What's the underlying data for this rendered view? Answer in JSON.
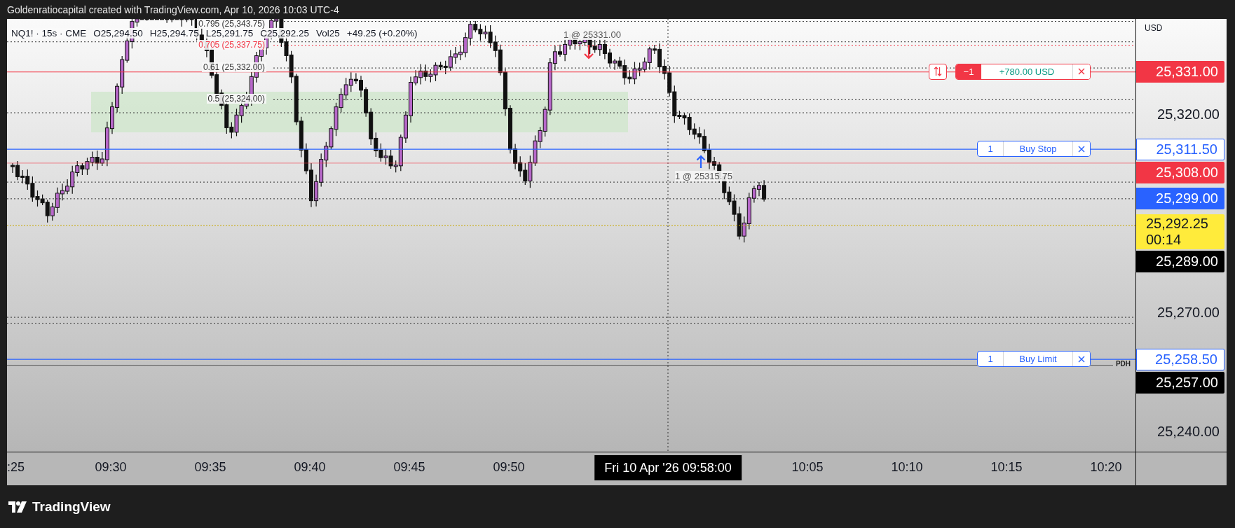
{
  "header": {
    "text": "Goldenratiocapital created with TradingView.com, Apr 10, 2026 10:03 UTC-4"
  },
  "legend": {
    "symbol": "NQ1! · 15s · CME",
    "open": "O25,294.50",
    "high": "H25,294.75",
    "low": "L25,291.75",
    "close": "C25,292.25",
    "volume": "Vol25",
    "change": "+49.25 (+0.20%)"
  },
  "fib_levels": [
    {
      "label": "0.795 (25,343.75)",
      "color": "#333333"
    },
    {
      "label": "0.705 (25,337.75)",
      "color": "#f23645"
    },
    {
      "label": "0.61 (25,332.00)",
      "color": "#333333"
    },
    {
      "label": "0.5 (25,324.00)",
      "color": "#333333"
    }
  ],
  "executions": [
    {
      "kind": "sell",
      "label": "1 @ 25331.00"
    },
    {
      "kind": "buy",
      "label": "1 @ 25315.75"
    }
  ],
  "orders": [
    {
      "kind": "position",
      "quantity": "−1",
      "pnl": "+780.00 USD",
      "price": "25,331.00",
      "color": "#f23645"
    },
    {
      "kind": "order",
      "quantity": "1",
      "label": "Buy Stop",
      "price": "25,311.50",
      "color": "#2962ff"
    },
    {
      "kind": "order",
      "quantity": "1",
      "label": "Buy Limit",
      "price": "25,258.50",
      "color": "#2962ff"
    }
  ],
  "price_axis": {
    "currency": "USD",
    "ticks": [
      "25,320.00",
      "25,270.00",
      "25,240.00"
    ],
    "labels": [
      {
        "kind": "stop",
        "text": "25,308.00",
        "color": "#f23645"
      },
      {
        "kind": "level",
        "text": "25,299.00",
        "color": "#2962ff"
      },
      {
        "kind": "last",
        "text": "25,292.25",
        "countdown": "00:14",
        "color": "#ffeb3b"
      },
      {
        "kind": "high",
        "text": "25,289.00",
        "color": "#000000"
      },
      {
        "kind": "pdh",
        "text": "25,257.00",
        "tag": "PDH",
        "color": "#000000"
      }
    ]
  },
  "time_axis": {
    "ticks": [
      ":25",
      "09:30",
      "09:35",
      "09:40",
      "09:45",
      "09:50",
      "10:05",
      "10:10",
      "10:15",
      "10:20"
    ],
    "crosshair": "Fri 10 Apr '26 09:58:00"
  },
  "footer": {
    "brand": "TradingView"
  }
}
